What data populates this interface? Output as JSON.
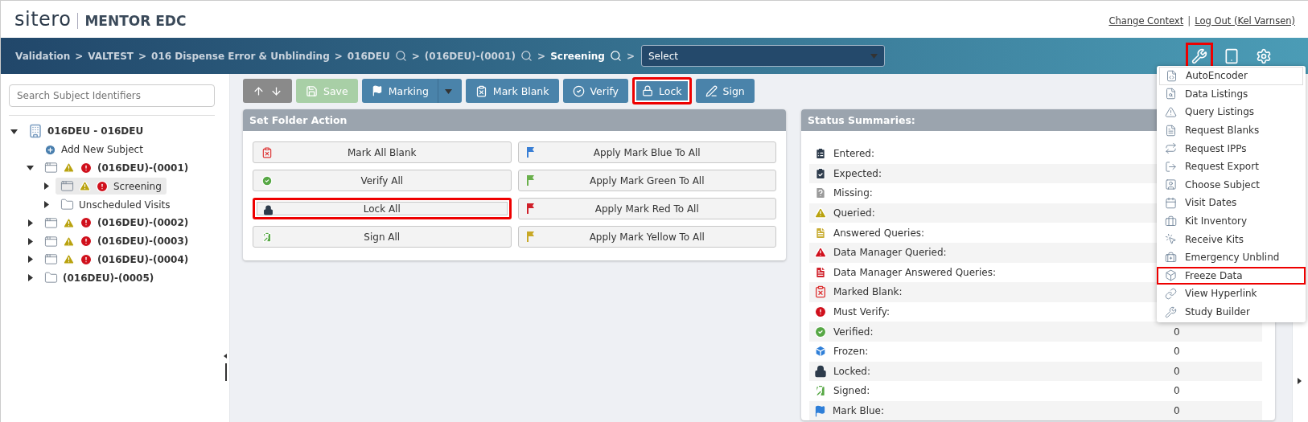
{
  "header": {
    "logo": "sitero",
    "product": "MENTOR EDC",
    "links": [
      {
        "label": "Change Context",
        "separator": "|"
      },
      {
        "label": "Log Out (Kel Varnsen)"
      }
    ]
  },
  "breadcrumbs": [
    {
      "label": "Validation",
      "current": false,
      "separator": ">"
    },
    {
      "label": "VALTEST",
      "current": false,
      "separator": ">"
    },
    {
      "label": "016 Dispense Error & Unblinding",
      "current": false,
      "separator": ">"
    },
    {
      "label": "016DEU",
      "search": true,
      "current": false,
      "separator": ">"
    },
    {
      "label": "(016DEU)-(0001)",
      "search": true,
      "current": false,
      "separator": ">"
    },
    {
      "label": "Screening",
      "search": true,
      "current": true,
      "separator": ">"
    }
  ],
  "form_select": {
    "value": "Select"
  },
  "tools": [
    {
      "kind": "wrench",
      "highlighted": true
    },
    {
      "kind": "tablet",
      "highlighted": false
    },
    {
      "kind": "settings",
      "highlighted": false
    }
  ],
  "sidebar": {
    "search": {
      "placeholder": "Search Subject Identifiers"
    },
    "tree": [
      {
        "kind": "site",
        "label": "016DEU - 016DEU",
        "expanded": true,
        "children": [
          {
            "kind": "add",
            "label": "Add New Subject"
          },
          {
            "kind": "subject",
            "label": "(016DEU)-(0001)",
            "expanded": true,
            "queried": true,
            "must_verify": true,
            "selected": false,
            "children": [
              {
                "kind": "subject",
                "label": "Screening",
                "expanded": false,
                "queried": true,
                "must_verify": true,
                "selected": true
              },
              {
                "kind": "folder",
                "label": "Unscheduled Visits",
                "expanded": false,
                "selected": false
              }
            ]
          },
          {
            "kind": "subject",
            "label": "(016DEU)-(0002)",
            "expanded": false,
            "queried": true,
            "must_verify": true,
            "selected": false
          },
          {
            "kind": "subject",
            "label": "(016DEU)-(0003)",
            "expanded": false,
            "queried": true,
            "must_verify": true,
            "selected": false
          },
          {
            "kind": "subject",
            "label": "(016DEU)-(0004)",
            "expanded": false,
            "queried": true,
            "must_verify": true,
            "selected": false
          },
          {
            "kind": "folder",
            "label": "(016DEU)-(0005)",
            "expanded": false,
            "selected": false
          }
        ]
      }
    ]
  },
  "toolbar": [
    {
      "kind": "arrows",
      "highlighted": false
    },
    {
      "kind": "save",
      "label": "Save",
      "disabled": true,
      "highlighted": false
    },
    {
      "kind": "marking",
      "label": "Marking",
      "disabled": false,
      "highlighted": false
    },
    {
      "kind": "mark-blank",
      "label": "Mark Blank",
      "disabled": false,
      "highlighted": false
    },
    {
      "kind": "verify",
      "label": "Verify",
      "disabled": false,
      "highlighted": false
    },
    {
      "kind": "lock",
      "label": "Lock",
      "disabled": false,
      "highlighted": true
    },
    {
      "kind": "sign",
      "label": "Sign",
      "disabled": false,
      "highlighted": false
    }
  ],
  "folder_action": {
    "title": "Set Folder Action",
    "buttons": [
      {
        "kind": "blank",
        "label": "Mark All Blank",
        "highlighted": false
      },
      {
        "kind": "flag",
        "color": "#3a7fd5",
        "label": "Apply Mark Blue To All",
        "highlighted": false
      },
      {
        "kind": "verify",
        "label": "Verify All",
        "highlighted": false
      },
      {
        "kind": "flag",
        "color": "#6ab04c",
        "label": "Apply Mark Green To All",
        "highlighted": false
      },
      {
        "kind": "lock",
        "label": "Lock All",
        "highlighted": true
      },
      {
        "kind": "flag",
        "color": "#d0202a",
        "label": "Apply Mark Red To All",
        "highlighted": false
      },
      {
        "kind": "sign",
        "label": "Sign All",
        "highlighted": false
      },
      {
        "kind": "flag",
        "color": "#c8a826",
        "label": "Apply Mark Yellow To All",
        "highlighted": false
      }
    ]
  },
  "status_summaries": {
    "title": "Status Summaries:",
    "rows": [
      {
        "kind": "entered",
        "label": "Entered:"
      },
      {
        "kind": "expected",
        "label": "Expected:"
      },
      {
        "kind": "missing",
        "label": "Missing:"
      },
      {
        "kind": "queried",
        "label": "Queried:"
      },
      {
        "kind": "answered",
        "label": "Answered Queries:"
      },
      {
        "kind": "dm-queried",
        "label": "Data Manager Queried:"
      },
      {
        "kind": "dm-answered",
        "label": "Data Manager Answered Queries:"
      },
      {
        "kind": "blank",
        "label": "Marked Blank:"
      },
      {
        "kind": "must-verify",
        "label": "Must Verify:"
      },
      {
        "kind": "verified",
        "label": "Verified:",
        "value": "0"
      },
      {
        "kind": "frozen",
        "label": "Frozen:",
        "value": "0"
      },
      {
        "kind": "locked",
        "label": "Locked:",
        "value": "0"
      },
      {
        "kind": "signed",
        "label": "Signed:",
        "value": "0"
      },
      {
        "kind": "mark-blue",
        "label": "Mark Blue:",
        "value": "0"
      }
    ]
  },
  "tools_menu": [
    {
      "kind": "code",
      "label": "AutoEncoder",
      "hovered": true,
      "highlighted": false
    },
    {
      "kind": "search-doc",
      "label": "Data Listings",
      "hovered": false,
      "highlighted": false
    },
    {
      "kind": "warning",
      "label": "Query Listings",
      "hovered": false,
      "highlighted": false
    },
    {
      "kind": "doc",
      "label": "Request Blanks",
      "hovered": false,
      "highlighted": false
    },
    {
      "kind": "swap",
      "label": "Request IPPs",
      "hovered": false,
      "highlighted": false
    },
    {
      "kind": "export",
      "label": "Request Export",
      "hovered": false,
      "highlighted": false
    },
    {
      "kind": "person",
      "label": "Choose Subject",
      "hovered": false,
      "highlighted": false
    },
    {
      "kind": "calendar",
      "label": "Visit Dates",
      "hovered": false,
      "highlighted": false
    },
    {
      "kind": "case",
      "label": "Kit Inventory",
      "hovered": false,
      "highlighted": false
    },
    {
      "kind": "pointer",
      "label": "Receive Kits",
      "hovered": false,
      "highlighted": false
    },
    {
      "kind": "medical",
      "label": "Emergency Unblind",
      "hovered": false,
      "highlighted": false
    },
    {
      "kind": "cube",
      "label": "Freeze Data",
      "hovered": false,
      "highlighted": true
    },
    {
      "kind": "link",
      "label": "View Hyperlink",
      "hovered": false,
      "highlighted": false
    },
    {
      "kind": "wrench",
      "label": "Study Builder",
      "hovered": false,
      "highlighted": false
    }
  ]
}
